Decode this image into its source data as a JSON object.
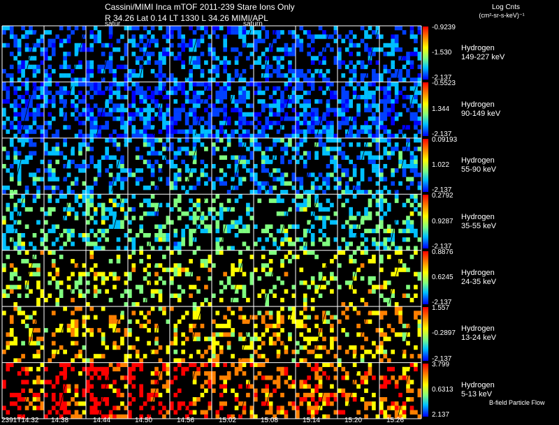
{
  "header": {
    "title": "Cassini/MIMI Inca mTOF  2011-239   Stare   Ions Only",
    "subtitle": "R         34.26 Lat 0.14 LT 1330 L         34.26  MIMI/APL",
    "sublabel_left": "satur",
    "sublabel_right": "saturn"
  },
  "colorbar": {
    "title": "Log Cnts",
    "units": "(cm²-sr-s-keV)⁻¹"
  },
  "legend": {
    "flow_label": "B-field Particle Flow"
  },
  "colors": {
    "background": "#000000",
    "grid_lines": "#ffffff",
    "colormap": [
      "#0000ff",
      "#0040ff",
      "#00c0ff",
      "#80ff80",
      "#ffff00",
      "#ff8000",
      "#ff0000"
    ]
  },
  "chart_data": {
    "type": "heatmap",
    "x_tick_labels": [
      "2391T14:32",
      "14:38",
      "14:44",
      "14:50",
      "14:56",
      "15:02",
      "15:08",
      "15:14",
      "15:20",
      "15:26"
    ],
    "rows": [
      {
        "species": "Hydrogen",
        "energy": "149-227 keV",
        "cb_max": "-0.9239",
        "cb_mid": "-1.530",
        "cb_min": "-2.137",
        "intensity": 0.22,
        "density": 0.45
      },
      {
        "species": "Hydrogen",
        "energy": "90-149 keV",
        "cb_max": "-0.5523",
        "cb_mid": "1.344",
        "cb_min": "-2.137",
        "intensity": 0.18,
        "density": 0.55
      },
      {
        "species": "Hydrogen",
        "energy": "55-90 keV",
        "cb_max": "0.09193",
        "cb_mid": "1.022",
        "cb_min": "-2.137",
        "intensity": 0.3,
        "density": 0.4
      },
      {
        "species": "Hydrogen",
        "energy": "35-55 keV",
        "cb_max": "0.2792",
        "cb_mid": "0.9287",
        "cb_min": "-2.137",
        "intensity": 0.42,
        "density": 0.35
      },
      {
        "species": "Hydrogen",
        "energy": "24-35 keV",
        "cb_max": "0.8876",
        "cb_mid": "0.6245",
        "cb_min": "-2.137",
        "intensity": 0.6,
        "density": 0.25
      },
      {
        "species": "Hydrogen",
        "energy": "13-24 keV",
        "cb_max": "1.557",
        "cb_mid": "-0.2897",
        "cb_min": "-2.137",
        "intensity": 0.72,
        "density": 0.28
      },
      {
        "species": "Hydrogen",
        "energy": "5-13 keV",
        "cb_max": "3.799",
        "cb_mid": "0.6313",
        "cb_min": "2.137",
        "intensity": 0.85,
        "density": 0.35
      }
    ]
  }
}
